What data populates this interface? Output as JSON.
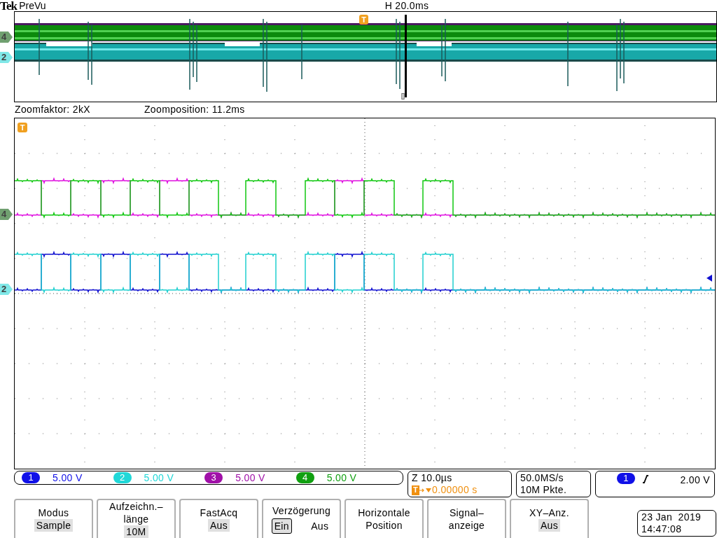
{
  "header": {
    "brand": "Tek",
    "mode": "PreVu",
    "horizontal_scale": "H 20.0ms"
  },
  "overview": {
    "trigger_marker": "T",
    "cursor_label": "[]",
    "channel_markers": [
      {
        "label": "4",
        "color": "#70a070"
      },
      {
        "label": "2",
        "color": "#80e8e8"
      }
    ]
  },
  "zoom": {
    "factor": "Zoomfaktor: 2kX",
    "position": "Zoomposition: 11.2ms"
  },
  "main": {
    "trigger_marker": "T",
    "channel_markers": [
      {
        "label": "4",
        "color": "#70a070"
      },
      {
        "label": "2",
        "color": "#80e8e8"
      }
    ]
  },
  "channels": [
    {
      "number": "1",
      "scale": "5.00 V",
      "color": "#1010e8"
    },
    {
      "number": "2",
      "scale": "5.00 V",
      "color": "#20d8d8"
    },
    {
      "number": "3",
      "scale": "5.00 V",
      "color": "#a010a8"
    },
    {
      "number": "4",
      "scale": "5.00 V",
      "color": "#10a010"
    }
  ],
  "timebase": {
    "zoom_scale": "Z 10.0µs",
    "trigger_icon": "T",
    "trigger_position": "0.00000 s"
  },
  "acquisition": {
    "sample_rate": "50.0MS/s",
    "record_length": "10M Pkte."
  },
  "trigger": {
    "source": "1",
    "color": "#1010e8",
    "level": "2.00 V"
  },
  "buttons": [
    {
      "kind": "value",
      "label_lines": [
        "Modus"
      ],
      "value": "Sample"
    },
    {
      "kind": "value",
      "label_lines": [
        "Aufzeichn.–",
        "länge"
      ],
      "value": "10M"
    },
    {
      "kind": "value",
      "label_lines": [
        "FastAcq"
      ],
      "value": "Aus"
    },
    {
      "kind": "toggle",
      "label_lines": [
        "Verzögerung"
      ],
      "options": [
        {
          "label": "Ein",
          "selected": true
        },
        {
          "label": "Aus",
          "selected": false
        }
      ]
    },
    {
      "kind": "plain",
      "label_lines": [
        "Horizontale",
        "Position"
      ]
    },
    {
      "kind": "plain",
      "label_lines": [
        "Signal–",
        "anzeige"
      ]
    },
    {
      "kind": "value",
      "label_lines": [
        "XY–Anz."
      ],
      "value": "Aus"
    }
  ],
  "datetime": {
    "date": "23 Jan  2019",
    "time": "14:47:08"
  }
}
